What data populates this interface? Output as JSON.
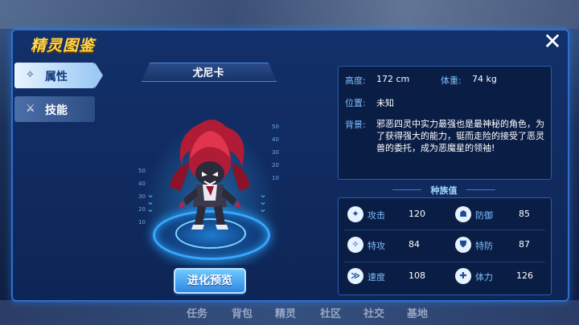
{
  "header": {
    "title": "精灵图鉴",
    "close_icon": "close-icon"
  },
  "tabs": [
    {
      "label": "属性",
      "icon": "sparkle-icon",
      "active": true
    },
    {
      "label": "技能",
      "icon": "wand-icon",
      "active": false
    }
  ],
  "creature": {
    "name": "尤尼卡",
    "evolve_label": "进化预览"
  },
  "info": {
    "height_label": "高度:",
    "height_value": "172 cm",
    "weight_label": "体重:",
    "weight_value": "74 kg",
    "location_label": "位置:",
    "location_value": "未知",
    "background_label": "背景:",
    "background_value": "邪恶四灵中实力最强也是最神秘的角色，为了获得强大的能力，铤而走险的接受了恶灵兽的委托，成为恶魔星的领袖!"
  },
  "race": {
    "title": "种族值",
    "stats": [
      {
        "label": "攻击",
        "value": "120",
        "icon": "attack-icon"
      },
      {
        "label": "防御",
        "value": "85",
        "icon": "defense-icon"
      },
      {
        "label": "特攻",
        "value": "84",
        "icon": "special-attack-icon"
      },
      {
        "label": "特防",
        "value": "87",
        "icon": "special-defense-icon"
      },
      {
        "label": "速度",
        "value": "108",
        "icon": "speed-icon"
      },
      {
        "label": "体力",
        "value": "126",
        "icon": "stamina-icon"
      }
    ]
  },
  "scale": {
    "left": [
      "50",
      "40",
      "30",
      "20",
      "10"
    ],
    "right": [
      "50",
      "40",
      "30",
      "20",
      "10"
    ]
  },
  "background_ui": {
    "bottom_tabs": [
      "任务",
      "背包",
      "精灵",
      "社区",
      "社交",
      "基地"
    ]
  },
  "colors": {
    "accent": "#2f6fd0",
    "title": "#ffd84a",
    "label": "#7fbfff"
  }
}
